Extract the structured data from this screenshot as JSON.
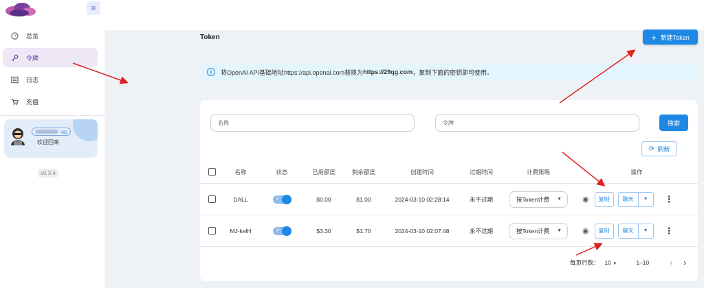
{
  "sidebar": {
    "items": [
      {
        "label": "总览",
        "icon": "dashboard-icon"
      },
      {
        "label": "令牌",
        "icon": "key-icon"
      },
      {
        "label": "日志",
        "icon": "log-icon"
      },
      {
        "label": "充值",
        "icon": "cart-icon"
      }
    ],
    "user": {
      "badge": "vip",
      "greeting": "欢迎回来"
    },
    "version": "v0.3.4"
  },
  "page": {
    "title": "Token",
    "new_button": "新建Token"
  },
  "alert": {
    "prefix": "将OpenAI API基础地址https://api.openai.com替换为",
    "url": "https://29qg.com",
    "suffix": "，复制下面的密钥即可使用。"
  },
  "filters": {
    "name_placeholder": "名称",
    "token_placeholder": "令牌",
    "search_button": "搜索",
    "refresh_button": "刷新"
  },
  "table": {
    "headers": [
      "名称",
      "状态",
      "已用额度",
      "剩余额度",
      "创建时间",
      "过期时间",
      "计费策略",
      "操作"
    ],
    "rows": [
      {
        "name": "DALL",
        "used": "$0.00",
        "remaining": "$1.00",
        "created": "2024-03-10 02:28:14",
        "expires": "永不过期",
        "billing": "按Token计费",
        "enabled": true
      },
      {
        "name": "MJ-kelH",
        "used": "$3.30",
        "remaining": "$1.70",
        "created": "2024-03-10 02:07:48",
        "expires": "永不过期",
        "billing": "按Token计费",
        "enabled": true
      }
    ],
    "copy_label": "复制",
    "chat_label": "聊天"
  },
  "pagination": {
    "rows_per_page_label": "每页行数：",
    "rows_per_page": "10",
    "range": "1–10"
  },
  "colors": {
    "primary": "#1e88e5",
    "annotation": "#e02020",
    "active_nav_bg": "#ede7f6"
  }
}
